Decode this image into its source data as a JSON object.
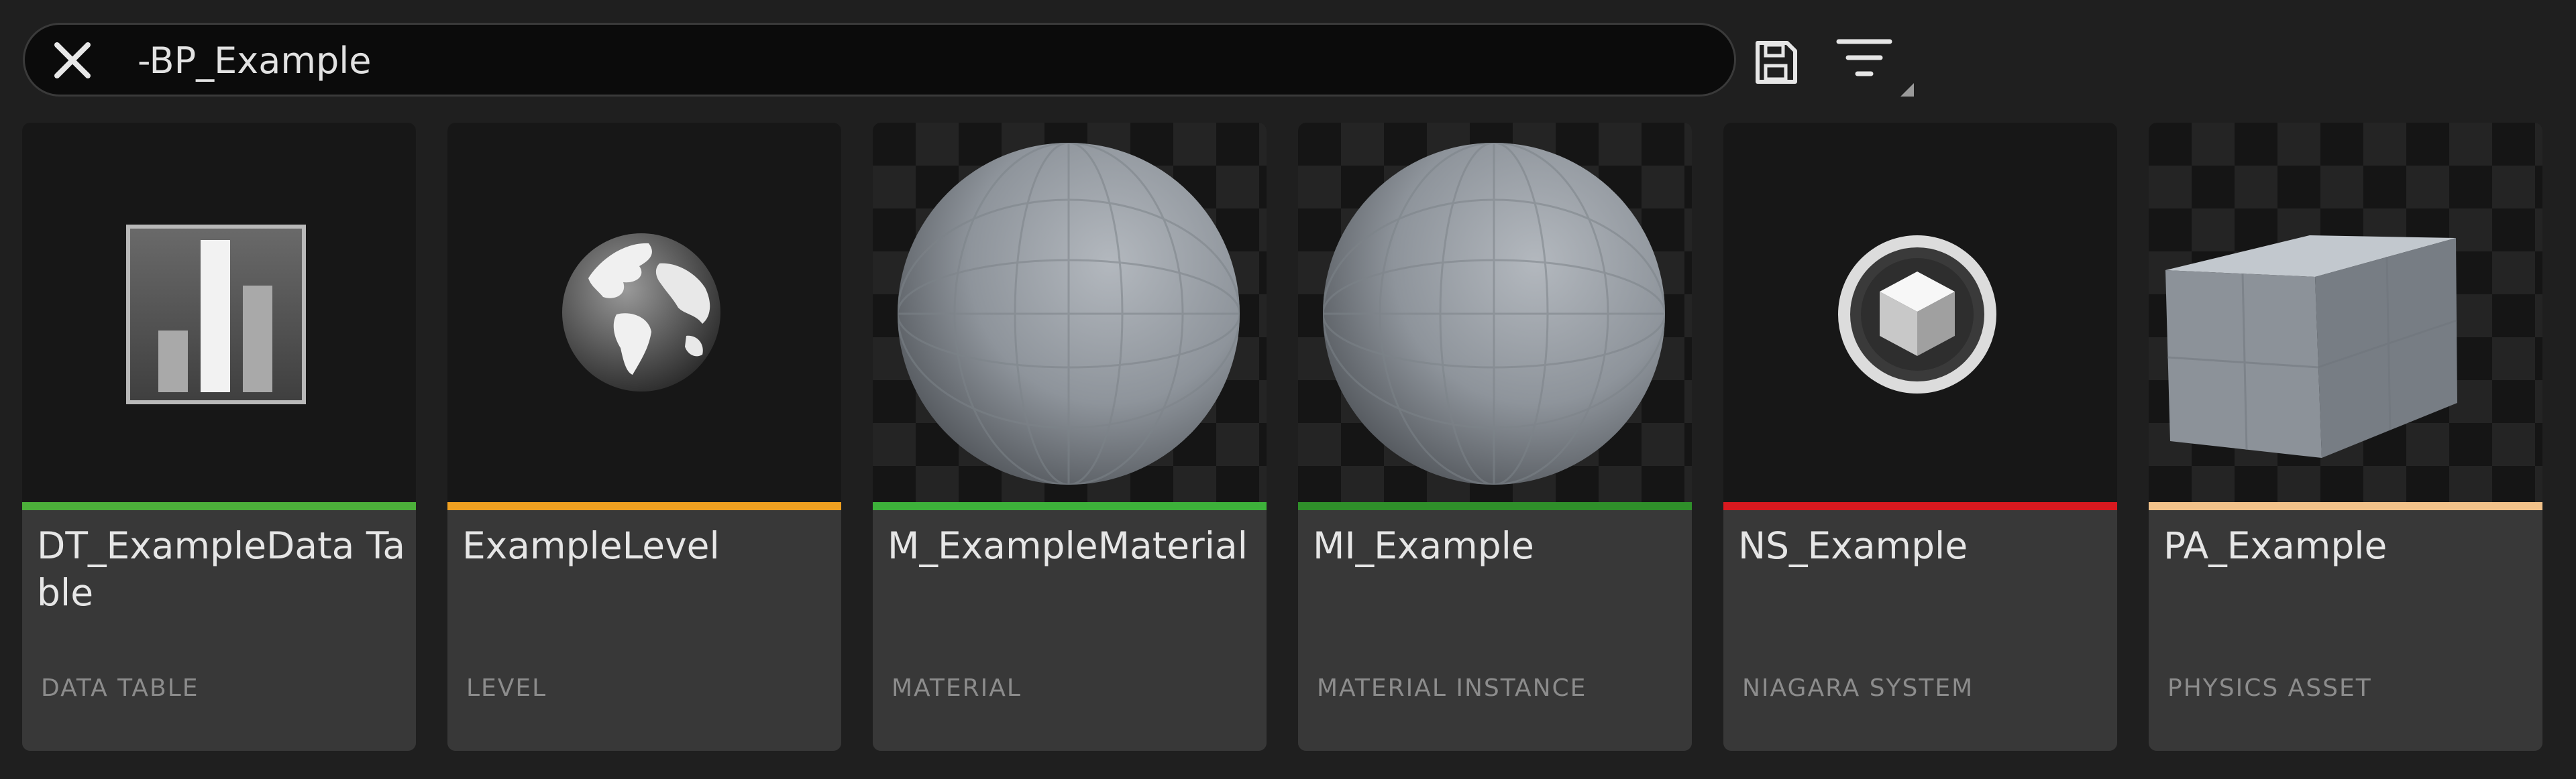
{
  "search": {
    "value": "-BP_Example",
    "placeholder": ""
  },
  "toolbar": {
    "save_icon": "save-icon",
    "filter_icon": "filter-icon"
  },
  "assets": [
    {
      "name": "DT_ExampleData Table",
      "type": "DATA TABLE",
      "color": "#4caf3a",
      "icon": "data-table-icon",
      "thumb": "plain"
    },
    {
      "name": "ExampleLevel",
      "type": "LEVEL",
      "color": "#f0a020",
      "icon": "globe-icon",
      "thumb": "plain"
    },
    {
      "name": "M_ExampleMaterial",
      "type": "MATERIAL",
      "color": "#3db13a",
      "icon": "material-sphere-preview",
      "thumb": "checker"
    },
    {
      "name": "MI_Example",
      "type": "MATERIAL INSTANCE",
      "color": "#2f8f2a",
      "icon": "material-instance-sphere-preview",
      "thumb": "checker"
    },
    {
      "name": "NS_Example",
      "type": "NIAGARA SYSTEM",
      "color": "#d8191f",
      "icon": "niagara-cube-icon",
      "thumb": "plain"
    },
    {
      "name": "PA_Example",
      "type": "PHYSICS ASSET",
      "color": "#f2c28a",
      "icon": "physics-box-preview",
      "thumb": "checker"
    }
  ]
}
